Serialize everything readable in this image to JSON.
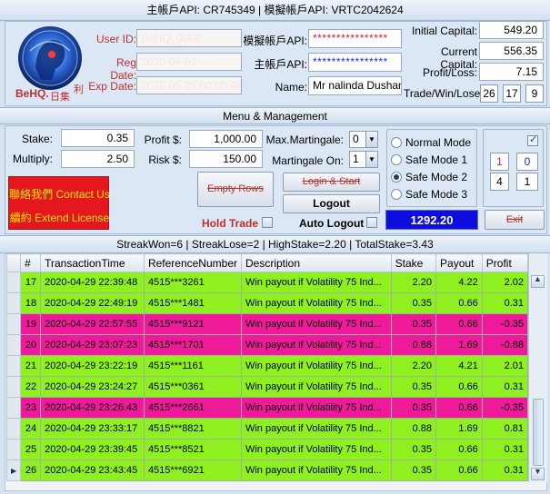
{
  "header": {
    "title": "主帳戶API: CR745349 | 模擬帳戶API: VRTC2042624"
  },
  "logo": {
    "text": "BeHQ.",
    "chinese": "日集",
    "chinese2": "利"
  },
  "user": {
    "user_id_label": "User ID:",
    "user_id_value": "BeHQ_0006",
    "reg_date_label": "Reg Date:",
    "reg_date_value": "2020-04-01 ...",
    "exp_date_label": "Exp Date:",
    "exp_date_value": "2020-05-25 00:00:48",
    "demo_api_label": "模擬帳戶API:",
    "demo_api_value": "****************",
    "main_api_label": "主帳戶API:",
    "main_api_value": "****************",
    "name_label": "Name:",
    "name_value": "Mr nalinda Dushanth"
  },
  "capital": {
    "initial_label": "Initial Capital:",
    "initial_value": "549.20",
    "current_label": "Current Capital:",
    "current_value": "556.35",
    "pl_label": "Profit/Loss:",
    "pl_value": "7.15",
    "twl_label": "Trade/Win/Lose:",
    "trade": "26",
    "win": "17",
    "lose": "9"
  },
  "menu": {
    "title": "Menu & Management",
    "stake_label": "Stake:",
    "stake_value": "0.35",
    "multiply_label": "Multiply:",
    "multiply_value": "2.50",
    "profit_label": "Profit $:",
    "profit_value": "1,000.00",
    "risk_label": "Risk $:",
    "risk_value": "150.00",
    "maxmart_label": "Max.Martingale:",
    "maxmart_value": "0",
    "marton_label": "Martingale On:",
    "marton_value": "1",
    "contact_label": "聯絡我們 Contact Us",
    "extend_label": "續約 Extend License",
    "empty_rows": "Empty Rows",
    "login_start": "Login & Start",
    "logout": "Logout",
    "hold_trade": "Hold Trade",
    "auto_logout": "Auto Logout",
    "balance": "1292.20",
    "exit": "Exit",
    "modes": [
      "Normal Mode",
      "Safe Mode 1",
      "Safe Mode 2",
      "Safe Mode 3"
    ],
    "selected_mode": "Safe Mode 2",
    "counter_a": "1",
    "counter_b": "0",
    "counter_c": "4",
    "counter_d": "1"
  },
  "status": {
    "text": "StreakWon=6 | StreakLose=2 | HighStake=2.20 | TotalStake=3.43"
  },
  "colors": {
    "win_row": "#8ef01f",
    "lose_row": "#ee1a9a",
    "balance_bg": "#0d0de0"
  },
  "table": {
    "columns": [
      "#",
      "TransactionTime",
      "ReferenceNumber",
      "Description",
      "Stake",
      "Payout",
      "Profit"
    ],
    "rows": [
      {
        "n": "17",
        "time": "2020-04-29 22:39:48",
        "ref": "4515***3261",
        "desc": "Win payout if Volatility 75 Ind...",
        "stake": "2.20",
        "payout": "4.22",
        "profit": "2.02",
        "result": "win"
      },
      {
        "n": "18",
        "time": "2020-04-29 22:49:19",
        "ref": "4515***1481",
        "desc": "Win payout if Volatility 75 Ind...",
        "stake": "0.35",
        "payout": "0.66",
        "profit": "0.31",
        "result": "win"
      },
      {
        "n": "19",
        "time": "2020-04-29 22:57:55",
        "ref": "4515***9121",
        "desc": "Win payout if Volatility 75 Ind...",
        "stake": "0.35",
        "payout": "0.66",
        "profit": "-0.35",
        "result": "lose"
      },
      {
        "n": "20",
        "time": "2020-04-29 23:07:23",
        "ref": "4515***1701",
        "desc": "Win payout if Volatility 75 Ind...",
        "stake": "0.88",
        "payout": "1.69",
        "profit": "-0.88",
        "result": "lose"
      },
      {
        "n": "21",
        "time": "2020-04-29 23:22:19",
        "ref": "4515***1161",
        "desc": "Win payout if Volatility 75 Ind...",
        "stake": "2.20",
        "payout": "4.21",
        "profit": "2.01",
        "result": "win"
      },
      {
        "n": "22",
        "time": "2020-04-29 23:24:27",
        "ref": "4515***0361",
        "desc": "Win payout if Volatility 75 Ind...",
        "stake": "0.35",
        "payout": "0.66",
        "profit": "0.31",
        "result": "win"
      },
      {
        "n": "23",
        "time": "2020-04-29 23:26:43",
        "ref": "4515***2661",
        "desc": "Win payout if Volatility 75 Ind...",
        "stake": "0.35",
        "payout": "0.66",
        "profit": "-0.35",
        "result": "lose"
      },
      {
        "n": "24",
        "time": "2020-04-29 23:33:17",
        "ref": "4515***8821",
        "desc": "Win payout if Volatility 75 Ind...",
        "stake": "0.88",
        "payout": "1.69",
        "profit": "0.81",
        "result": "win"
      },
      {
        "n": "25",
        "time": "2020-04-29 23:39:45",
        "ref": "4515***8521",
        "desc": "Win payout if Volatility 75 Ind...",
        "stake": "0.35",
        "payout": "0.66",
        "profit": "0.31",
        "result": "win"
      },
      {
        "n": "26",
        "time": "2020-04-29 23:43:45",
        "ref": "4515***6921",
        "desc": "Win payout if Volatility 75 Ind...",
        "stake": "0.35",
        "payout": "0.66",
        "profit": "0.31",
        "result": "win",
        "current": true
      }
    ]
  }
}
